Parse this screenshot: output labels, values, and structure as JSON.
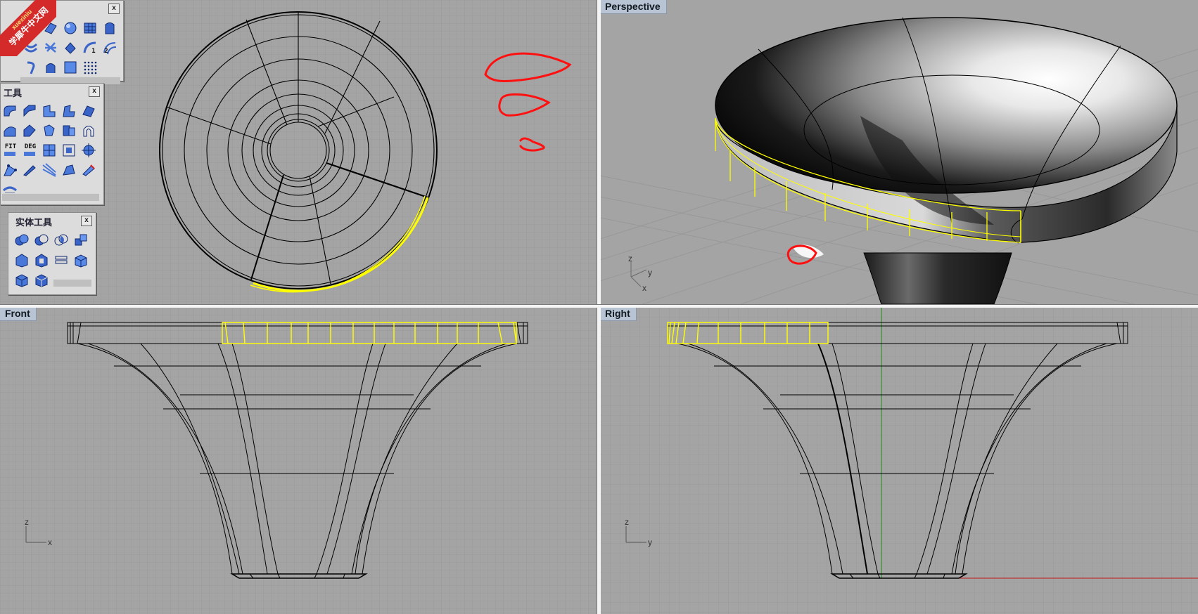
{
  "viewports": {
    "top": {
      "label": ""
    },
    "perspective": {
      "label": "Perspective"
    },
    "front": {
      "label": "Front"
    },
    "right": {
      "label": "Right"
    }
  },
  "axes": {
    "perspective": {
      "z": "z",
      "y": "y",
      "x": "x"
    },
    "front": {
      "z": "z",
      "x": "x"
    },
    "right": {
      "z": "z",
      "y": "y"
    }
  },
  "panels": {
    "surface_tools": {
      "title": "工具",
      "close": "x"
    },
    "solid_tools": {
      "title": "实体工具",
      "close": "x"
    },
    "top_panel": {
      "close": "x"
    }
  },
  "tool_text": {
    "fit": "FIT",
    "deg": "DEG",
    "num1": "1",
    "num2": "2"
  },
  "watermark": {
    "line1": "xuexiniu",
    "line2": "学犀牛中文网"
  },
  "colors": {
    "viewport_bg": "#a4a4a4",
    "grid": "#9a9a9a",
    "selection": "#ffff00",
    "annotation": "#ff0000",
    "wire": "#000000"
  }
}
